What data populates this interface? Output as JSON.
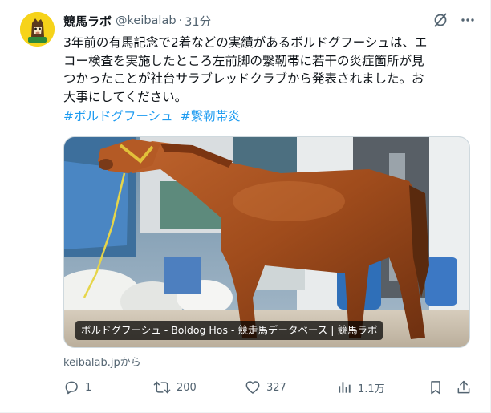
{
  "post": {
    "author": {
      "name": "競馬ラボ",
      "handle": "@keibalab",
      "separator": "·",
      "time": "31分",
      "avatar_text": "競馬ラボ"
    },
    "text_lines": [
      "3年前の有馬記念で2着などの実績があるボルドグフーシュは、エ",
      "コー検査を実施したところ左前脚の繋靭帯に若干の炎症箇所が見",
      "つかったことが社台サラブレッドクラブから発表されました。お",
      "大事にしてください。"
    ],
    "hashtags": [
      "#ボルドグフーシュ",
      "#繋靭帯炎"
    ],
    "card": {
      "caption": "ボルドグフーシュ - Boldog Hos - 競走馬データベース | 競馬ラボ",
      "source": "keibalab.jpから"
    },
    "metrics": {
      "replies": "1",
      "reposts": "200",
      "likes": "327",
      "views": "1.1万"
    }
  },
  "colors": {
    "text": "#0f1419",
    "secondary": "#536471",
    "link": "#1d9bf0",
    "avatar_bg": "#f6d31a"
  },
  "icons": [
    "grok-icon",
    "more-icon",
    "reply-icon",
    "repost-icon",
    "like-icon",
    "views-icon",
    "bookmark-icon",
    "share-icon"
  ]
}
